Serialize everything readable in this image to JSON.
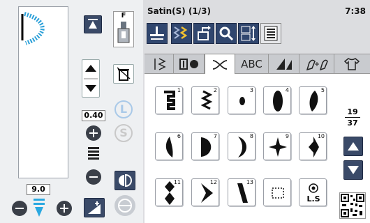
{
  "left_panel": {
    "foot_label": "F",
    "width_value": "0.40",
    "length_value": "9.0",
    "l_badge": "L",
    "s_badge": "S"
  },
  "header": {
    "title": "Satin(S) (1/3)",
    "clock": "7:38"
  },
  "tabs": [
    {
      "name": "utility-stitches",
      "label": ""
    },
    {
      "name": "buttonhole",
      "label": ""
    },
    {
      "name": "decorative",
      "label": ""
    },
    {
      "name": "alphabet",
      "label": "ABC"
    },
    {
      "name": "satin-patterns",
      "label": ""
    },
    {
      "name": "combine",
      "label": ""
    },
    {
      "name": "garment",
      "label": ""
    }
  ],
  "stitches": [
    {
      "num": "1",
      "icon": "zigzag-block"
    },
    {
      "num": "2",
      "icon": "zigzag-line"
    },
    {
      "num": "3",
      "icon": "dot-satin"
    },
    {
      "num": "4",
      "icon": "oval-satin"
    },
    {
      "num": "5",
      "icon": "leaf-satin"
    },
    {
      "num": "6",
      "icon": "teardrop-satin"
    },
    {
      "num": "7",
      "icon": "half-moon-satin"
    },
    {
      "num": "8",
      "icon": "crescent-satin"
    },
    {
      "num": "9",
      "icon": "star-satin"
    },
    {
      "num": "10",
      "icon": "half-diamond-satin"
    },
    {
      "num": "11",
      "icon": "diamond-chain-satin"
    },
    {
      "num": "12",
      "icon": "arrow-satin"
    },
    {
      "num": "13",
      "icon": "bar-satin"
    },
    {
      "num": "",
      "icon": "empty-slot"
    },
    {
      "num": "",
      "icon": "ls-selector",
      "label": "L.S"
    }
  ],
  "pagination": {
    "current": "19",
    "total": "37"
  },
  "colors": {
    "accent": "#30466e",
    "highlight": "#f2c230",
    "cyan": "#2aa8e0"
  }
}
